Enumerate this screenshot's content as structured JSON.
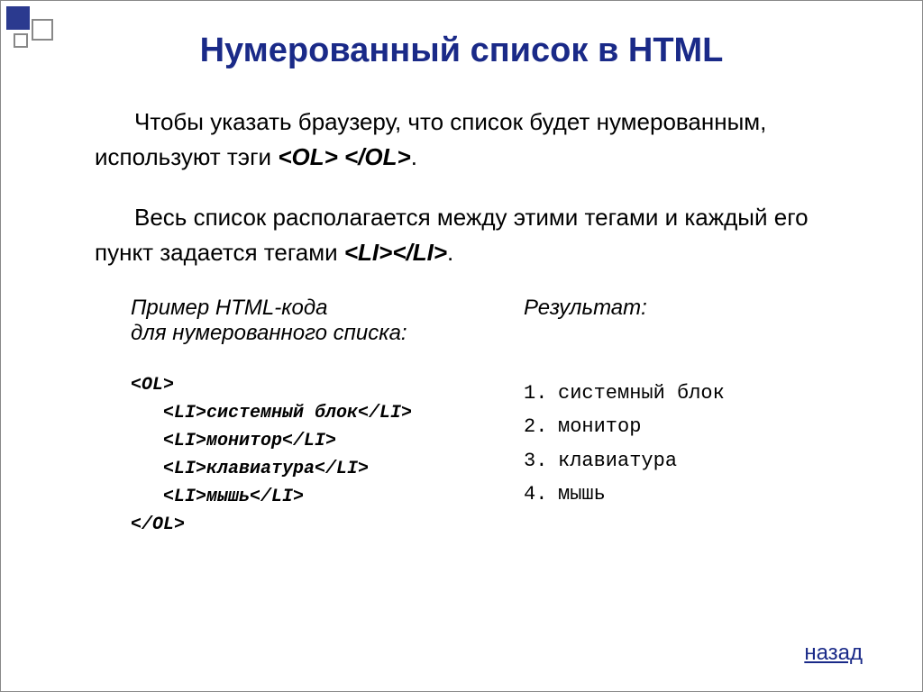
{
  "title": "Нумерованный список в HTML",
  "paragraph1_a": "Чтобы указать браузеру, что список будет нумерованным, используют тэги ",
  "paragraph1_b": "<OL> </OL>",
  "paragraph1_c": ".",
  "paragraph2_a": "Весь список располагается между этими тегами и каждый его пункт задается тегами ",
  "paragraph2_b": "<LI></LI>",
  "paragraph2_c": ".",
  "example_label_left_1": "Пример HTML-кода",
  "example_label_left_2": "для нумерованного списка:",
  "example_label_right": "Результат:",
  "code": {
    "l1": "<OL>",
    "l2": "   <LI>системный блок</LI>",
    "l3": "   <LI>монитор</LI>",
    "l4": "   <LI>клавиатура</LI>",
    "l5": "   <LI>мышь</LI>",
    "l6": "</OL>"
  },
  "result": {
    "items": [
      "системный блок",
      "монитор",
      "клавиатура",
      "мышь"
    ],
    "n1": "1.",
    "n2": "2.",
    "n3": "3.",
    "n4": "4.",
    "t1": "системный блок",
    "t2": "монитор",
    "t3": "клавиатура",
    "t4": "мышь"
  },
  "back_link": "назад"
}
